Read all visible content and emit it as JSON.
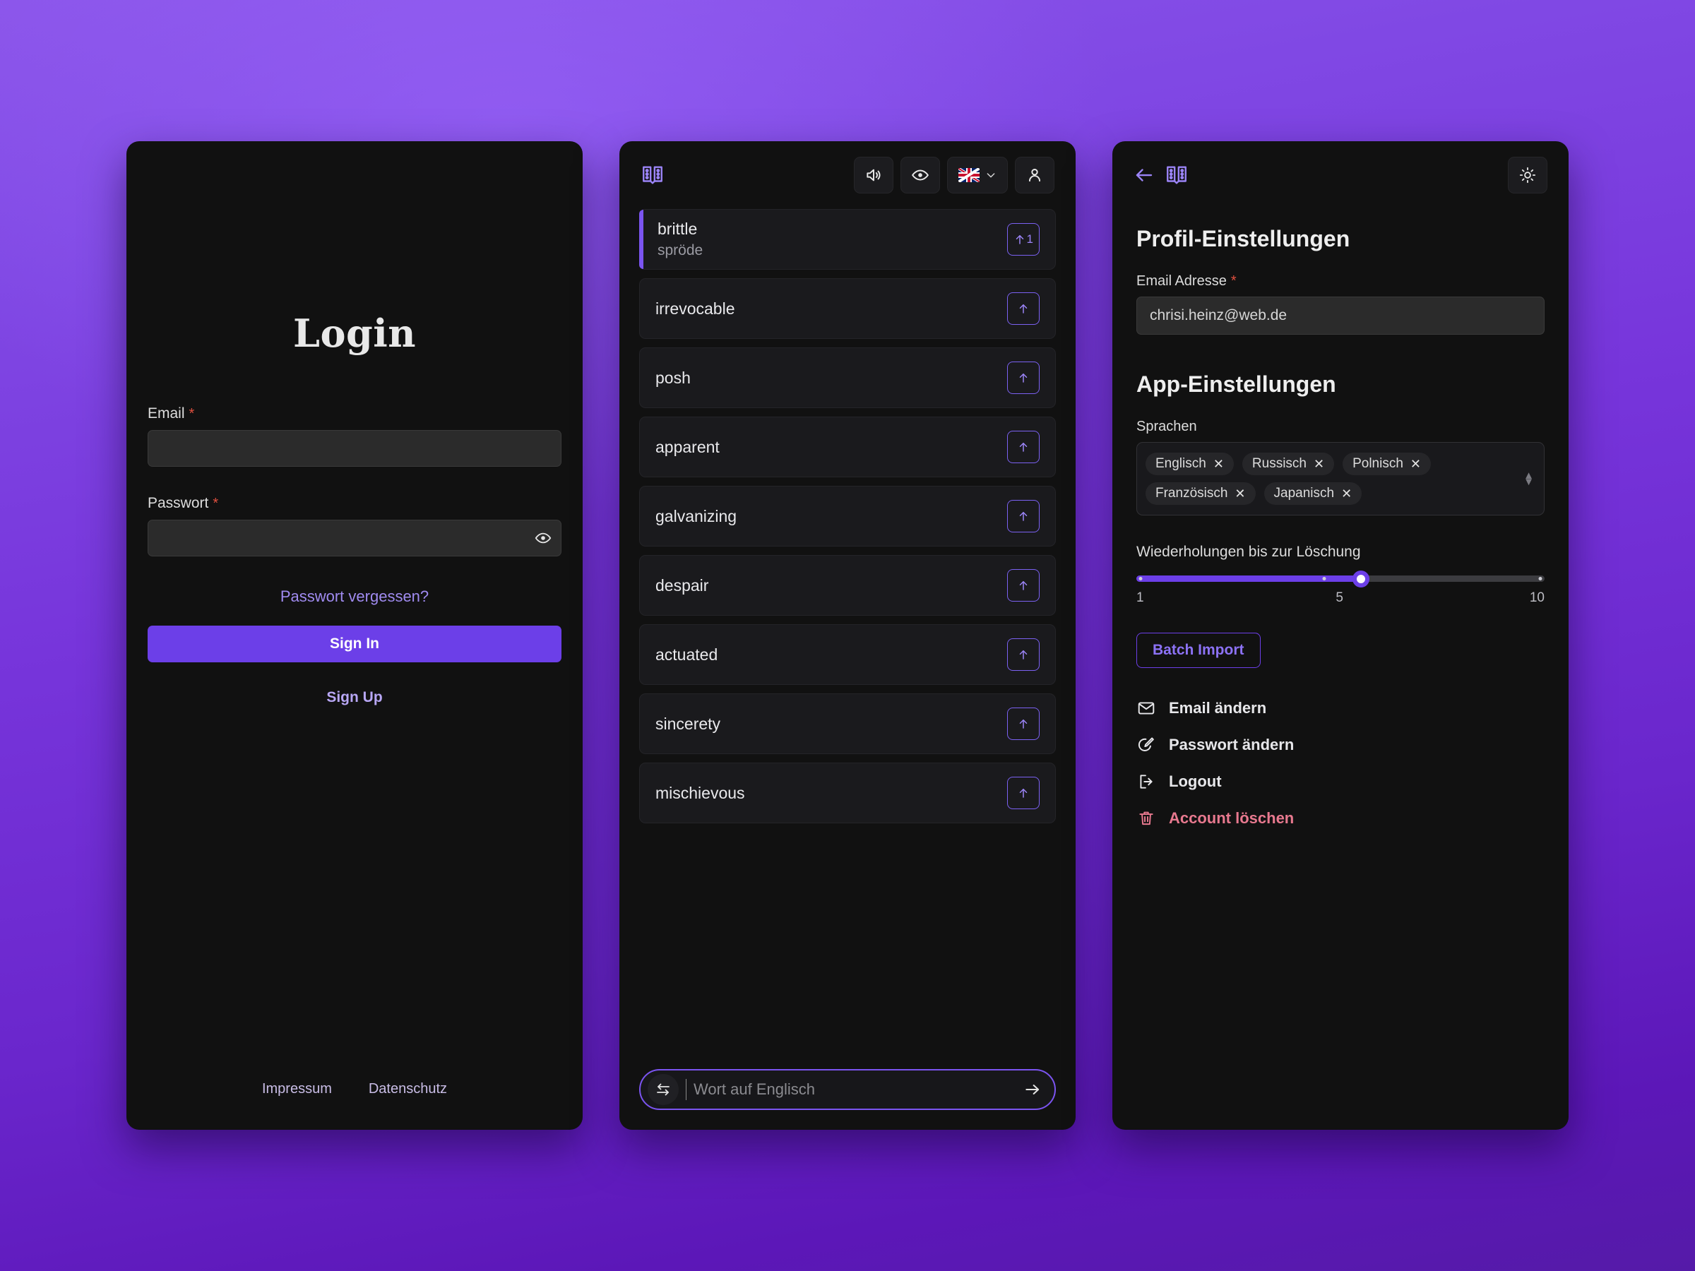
{
  "background": {
    "gradient_top": "#8b55ea",
    "gradient_bottom": "#551aa8"
  },
  "theme": {
    "accent": "#6c3fe8",
    "accent_light": "#9b84f7",
    "danger": "#e8798f",
    "required": "#e0503f"
  },
  "login": {
    "title": "Login",
    "email": {
      "label": "Email",
      "required_mark": "*",
      "value": "",
      "placeholder": ""
    },
    "password": {
      "label": "Passwort",
      "required_mark": "*",
      "value": "",
      "placeholder": "",
      "toggle_icon": "eye-icon"
    },
    "forgot_link": "Passwort vergessen?",
    "signin_button": "Sign In",
    "signup_link": "Sign Up",
    "legal": {
      "imprint": "Impressum",
      "privacy": "Datenschutz"
    }
  },
  "words_panel": {
    "brand_icon": "open-book-icon",
    "toolbar": [
      {
        "name": "speaker-icon",
        "label": ""
      },
      {
        "name": "eye-icon",
        "label": ""
      },
      {
        "name": "language-flag-uk",
        "label": "",
        "chevron": "chevron-down-icon"
      },
      {
        "name": "user-icon",
        "label": ""
      }
    ],
    "words": [
      {
        "en": "brittle",
        "de": "spröde",
        "active": true,
        "count": "1"
      },
      {
        "en": "irrevocable",
        "de": "",
        "active": false,
        "count": ""
      },
      {
        "en": "posh",
        "de": "",
        "active": false,
        "count": ""
      },
      {
        "en": "apparent",
        "de": "",
        "active": false,
        "count": ""
      },
      {
        "en": "galvanizing",
        "de": "",
        "active": false,
        "count": ""
      },
      {
        "en": "despair",
        "de": "",
        "active": false,
        "count": ""
      },
      {
        "en": "actuated",
        "de": "",
        "active": false,
        "count": ""
      },
      {
        "en": "sincerety",
        "de": "",
        "active": false,
        "count": ""
      },
      {
        "en": "mischievous",
        "de": "",
        "active": false,
        "count": ""
      }
    ],
    "search": {
      "swap_icon": "swap-arrows-icon",
      "placeholder": "Wort auf Englisch",
      "value": "",
      "submit_icon": "arrow-right-icon"
    }
  },
  "settings_panel": {
    "back_icon": "arrow-left-icon",
    "brand_icon": "open-book-icon",
    "theme_toggle_icon": "sun-icon",
    "profile_heading": "Profil-Einstellungen",
    "email": {
      "label": "Email Adresse",
      "required_mark": "*",
      "value": "chrisi.heinz@web.de"
    },
    "app_heading": "App-Einstellungen",
    "languages": {
      "label": "Sprachen",
      "chips": [
        "Englisch",
        "Russisch",
        "Polnisch",
        "Französisch",
        "Japanisch"
      ],
      "remove_glyph": "✕",
      "stepper_icon": "chevron-up-down-icon"
    },
    "repetitions": {
      "label": "Wiederholungen bis zur Löschung",
      "min": "1",
      "mid": "5",
      "max": "10",
      "value": 6,
      "fill_percent": 55
    },
    "batch_import_button": "Batch Import",
    "actions": [
      {
        "icon": "mail-icon",
        "label": "Email ändern",
        "danger": false
      },
      {
        "icon": "pencil-edit-icon",
        "label": "Passwort ändern",
        "danger": false
      },
      {
        "icon": "logout-icon",
        "label": "Logout",
        "danger": false
      },
      {
        "icon": "trash-icon",
        "label": "Account löschen",
        "danger": true
      }
    ]
  }
}
